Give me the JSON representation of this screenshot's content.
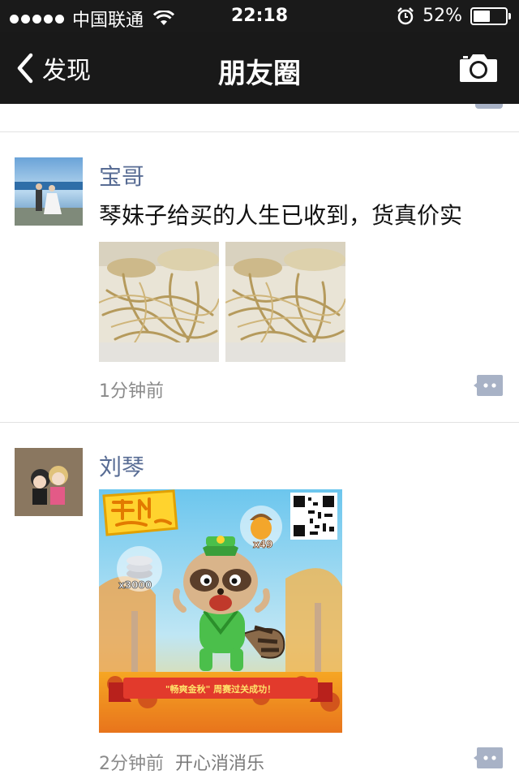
{
  "status_bar": {
    "carrier": "中国联通",
    "time": "22:18",
    "battery": "52%",
    "battery_level": 0.52
  },
  "nav": {
    "back_label": "发现",
    "title": "朋友圈"
  },
  "posts": [
    {
      "username": "宝哥",
      "text": "琴妹子给买的人生已收到，货真价实",
      "time": "1分钟前"
    },
    {
      "username": "刘琴",
      "time": "2分钟前",
      "source": "开心消消乐",
      "game_card": {
        "logo_text": "开心消消乐",
        "acorn_count": "x49",
        "coin_count": "x3000",
        "banner_text": "\"畅爽金秋\" 周赛过关成功！"
      }
    }
  ],
  "colors": {
    "nav_bg": "#191919",
    "username": "#586c94",
    "comment_icon": "#a8b2c6"
  }
}
